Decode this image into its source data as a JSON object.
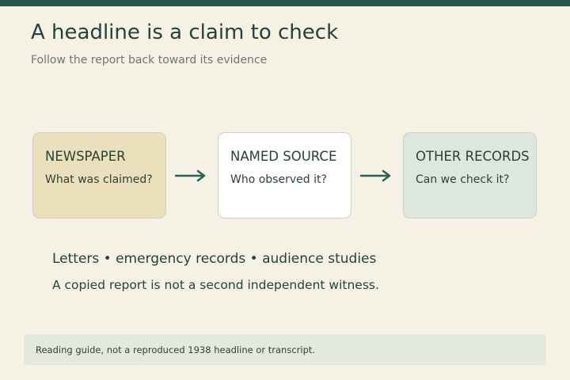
{
  "header": {
    "title": "A headline is a claim to check",
    "subtitle": "Follow the report back toward its evidence"
  },
  "flow": {
    "steps": [
      {
        "label": "NEWSPAPER",
        "question": "What was claimed?",
        "color": "#ecdfbb"
      },
      {
        "label": "NAMED SOURCE",
        "question": "Who observed it?",
        "color": "#ffffff"
      },
      {
        "label": "OTHER RECORDS",
        "question": "Can we check it?",
        "color": "#dde7de"
      }
    ],
    "arrow_color": "#2b5f5a"
  },
  "body": {
    "sources": "Letters • emergency records • audience studies",
    "note": "A copied report is not a second independent witness."
  },
  "footer": {
    "text": "Reading guide, not a reproduced 1938 headline or transcript."
  },
  "colors": {
    "accent": "#24564e",
    "background": "#f6f1e5",
    "footer_bg": "#e3e9dd"
  }
}
